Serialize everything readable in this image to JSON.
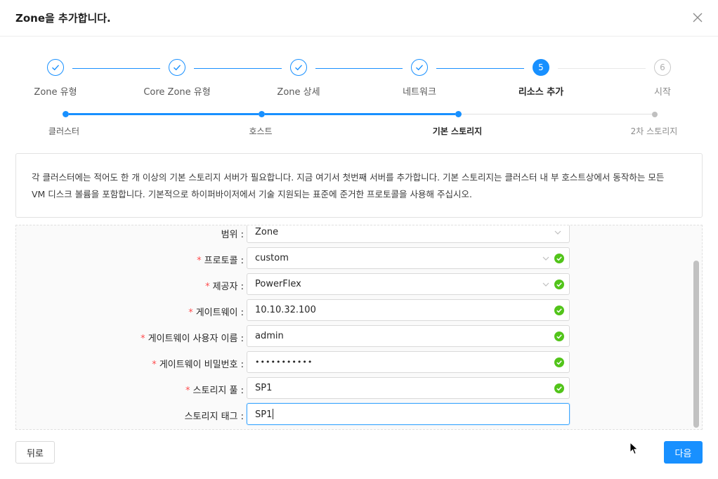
{
  "dialog": {
    "title": "Zone을 추가합니다.",
    "close_icon": "close-icon"
  },
  "steps": [
    {
      "label": "Zone 유형",
      "status": "done"
    },
    {
      "label": "Core Zone 유형",
      "status": "done"
    },
    {
      "label": "Zone 상세",
      "status": "done"
    },
    {
      "label": "네트워크",
      "status": "done"
    },
    {
      "label": "리소스 추가",
      "status": "active",
      "number": "5"
    },
    {
      "label": "시작",
      "status": "wait",
      "number": "6"
    }
  ],
  "substeps": [
    {
      "label": "클러스터",
      "status": "done"
    },
    {
      "label": "호스트",
      "status": "done"
    },
    {
      "label": "기본 스토리지",
      "status": "active"
    },
    {
      "label": "2차 스토리지",
      "status": "wait"
    }
  ],
  "description": {
    "line1": "각 클러스터에는 적어도 한 개 이상의 기본 스토리지 서버가 필요합니다. 지금 여기서 첫번째 서버를 추가합니다. 기본 스토리지는 클러스터 내 부 호스트상에서 동작하는 모든",
    "line2": "VM 디스크 볼륨을 포함합니다. 기본적으로 하이퍼바이저에서 기술 지원되는 표준에 준거한 프로토콜을 사용해 주십시오."
  },
  "form": {
    "fields": [
      {
        "label": "범위 :",
        "value": "Zone",
        "required": false,
        "type": "select",
        "validated": false
      },
      {
        "label": "프로토콜 :",
        "value": "custom",
        "required": true,
        "type": "select",
        "validated": true
      },
      {
        "label": "제공자 :",
        "value": "PowerFlex",
        "required": true,
        "type": "select",
        "validated": true
      },
      {
        "label": "게이트웨이 :",
        "value": "10.10.32.100",
        "required": true,
        "type": "text",
        "validated": true
      },
      {
        "label": "게이트웨이 사용자 이름 :",
        "value": "admin",
        "required": true,
        "type": "text",
        "validated": true
      },
      {
        "label": "게이트웨이 비밀번호 :",
        "value": "•••••••••••",
        "required": true,
        "type": "password",
        "validated": true
      },
      {
        "label": "스토리지 풀 :",
        "value": "SP1",
        "required": true,
        "type": "text",
        "validated": true
      },
      {
        "label": "스토리지 태그 :",
        "value": "SP1",
        "required": false,
        "type": "text",
        "validated": false,
        "focused": true
      }
    ]
  },
  "footer": {
    "back_label": "뒤로",
    "next_label": "다음"
  },
  "colors": {
    "primary": "#1890ff",
    "success": "#52c41a",
    "required": "#ff4d4f"
  }
}
